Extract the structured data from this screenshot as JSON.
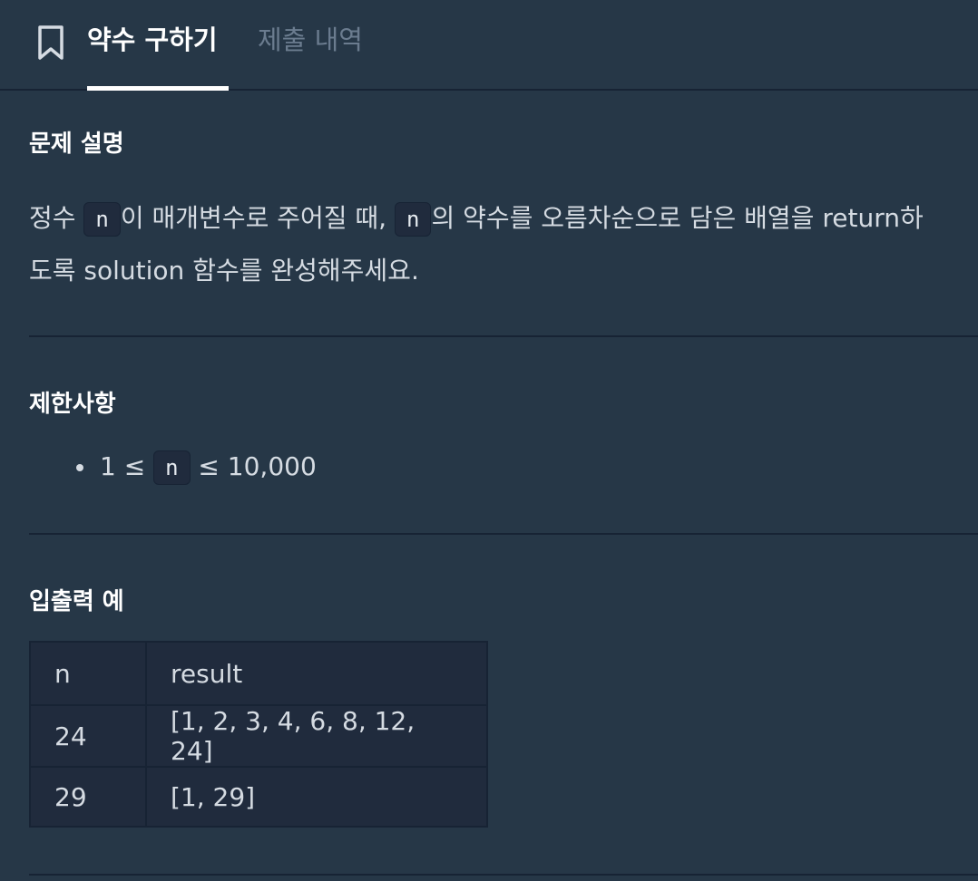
{
  "tabs": {
    "active_label": "약수 구하기",
    "inactive_label": "제출 내역"
  },
  "description": {
    "heading": "문제 설명",
    "part1": "정수 ",
    "code1": "n",
    "part2": "이 매개변수로 주어질 때, ",
    "code2": "n",
    "part3": "의 약수를 오름차순으로 담은 배열을 return하도록 solution 함수를 완성해주세요."
  },
  "constraints": {
    "heading": "제한사항",
    "item_prefix": "1 ≤ ",
    "item_code": "n",
    "item_suffix": " ≤ 10,000"
  },
  "examples": {
    "heading": "입출력 예",
    "columns": [
      "n",
      "result"
    ],
    "rows": [
      [
        "24",
        "[1, 2, 3, 4, 6, 8, 12, 24]"
      ],
      [
        "29",
        "[1, 29]"
      ]
    ]
  }
}
